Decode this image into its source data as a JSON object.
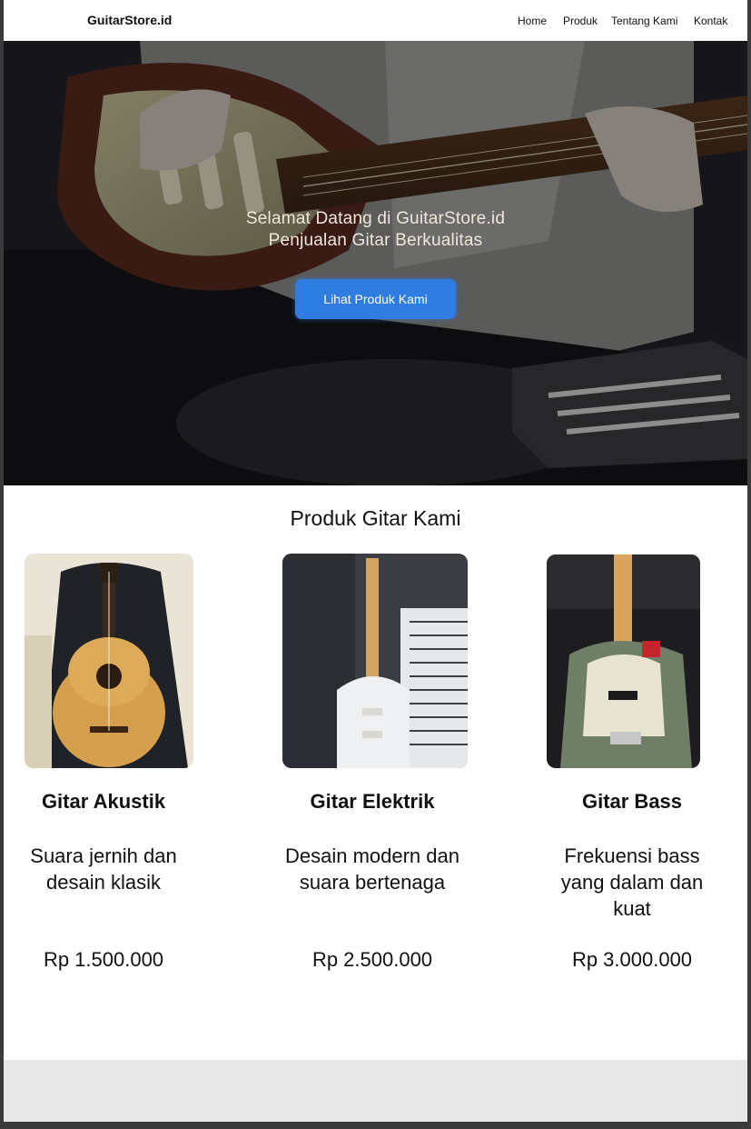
{
  "nav": {
    "brand": "GuitarStore.id",
    "links": [
      "Home",
      "Produk",
      "Tentang Kami",
      "Kontak"
    ]
  },
  "hero": {
    "line1": "Selamat Datang di GuitarStore.id",
    "line2": "Penjualan Gitar Berkualitas",
    "button": "Lihat Produk Kami"
  },
  "products": {
    "title": "Produk Gitar Kami",
    "items": [
      {
        "name": "Gitar Akustik",
        "desc": "Suara jernih dan desain klasik",
        "price": "Rp 1.500.000"
      },
      {
        "name": "Gitar Elektrik",
        "desc": "Desain modern dan suara bertenaga",
        "price": "Rp 2.500.000"
      },
      {
        "name": "Gitar Bass",
        "desc": "Frekuensi bass yang dalam dan kuat",
        "price": "Rp 3.000.000"
      }
    ]
  },
  "colors": {
    "accent": "#2f7de1",
    "footer": "#e8e8e8"
  }
}
